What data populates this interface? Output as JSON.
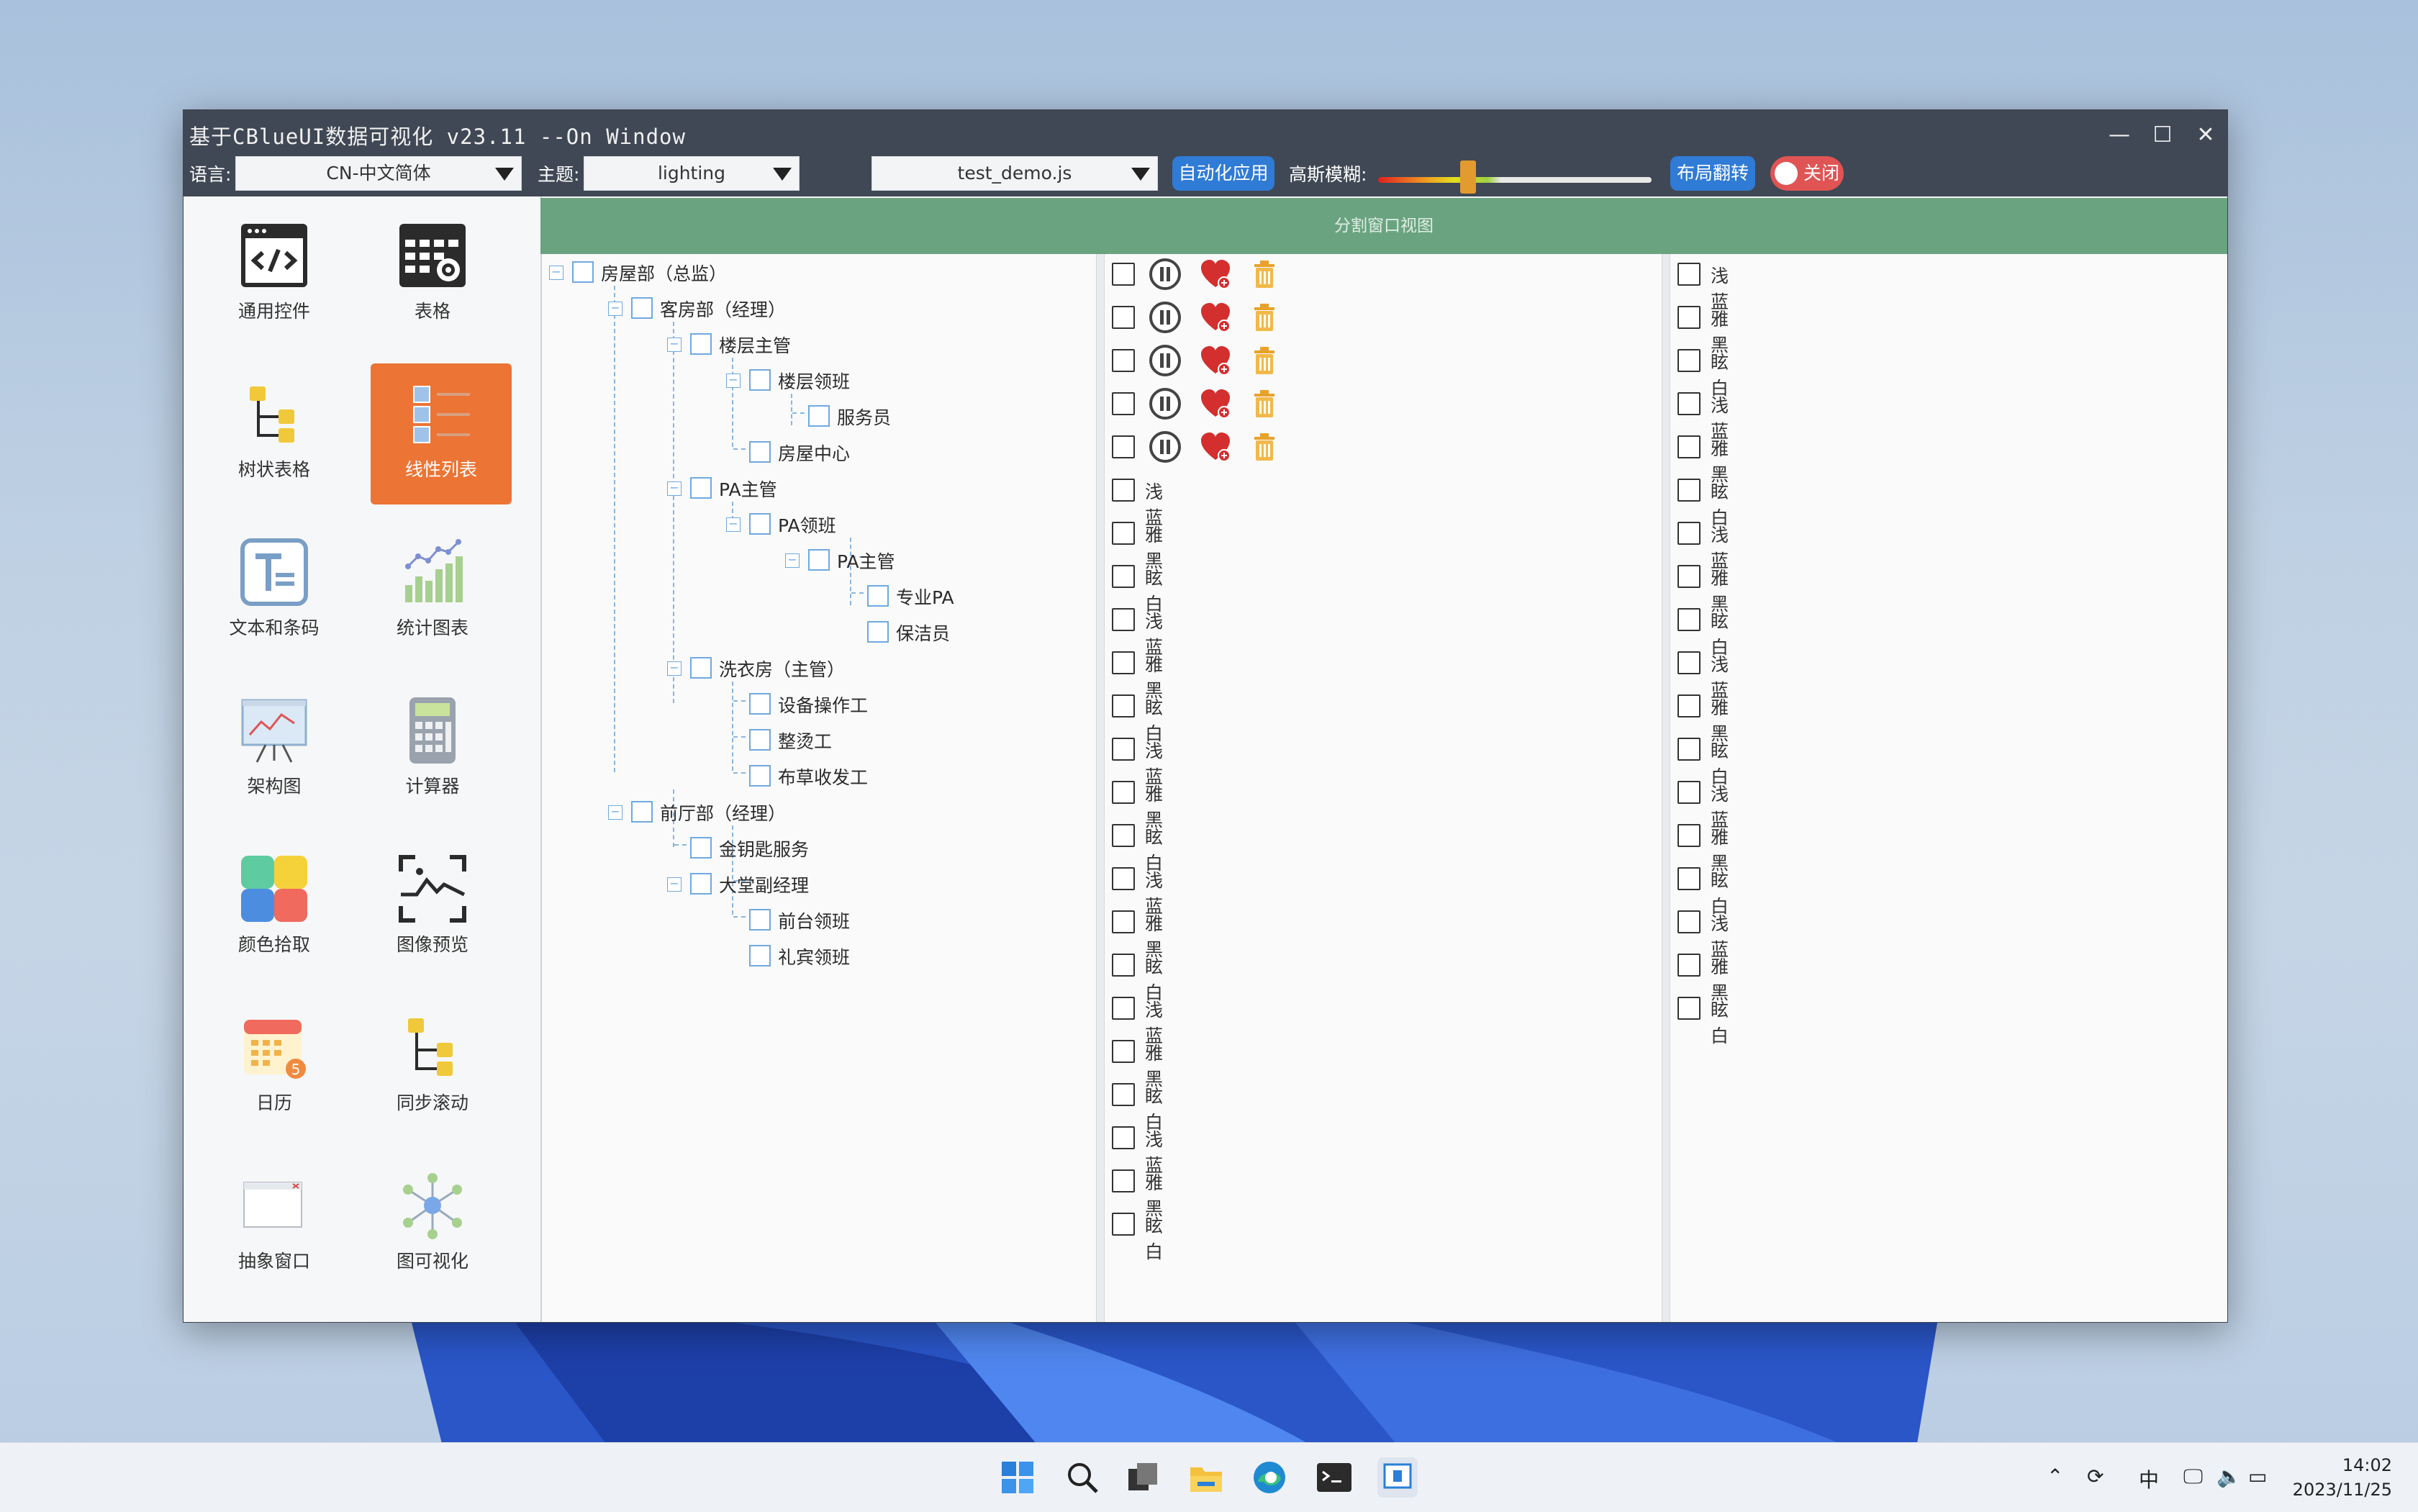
{
  "window": {
    "title": "基于CBlueUI数据可视化 v23.11 --On Window"
  },
  "toolbar": {
    "lang_label": "语言:",
    "lang_value": "CN-中文简体",
    "theme_label": "主题:",
    "theme_value": "lighting",
    "script_value": "test_demo.js",
    "auto_btn": "自动化应用",
    "blur_label": "高斯模糊:",
    "blur_level": 0.33,
    "flip_btn": "布局翻转",
    "toggle_label": "关闭"
  },
  "sidebar": {
    "items": [
      {
        "label": "通用控件",
        "icon": "code-window-icon"
      },
      {
        "label": "表格",
        "icon": "table-gear-icon"
      },
      {
        "label": "树状表格",
        "icon": "tree-table-icon"
      },
      {
        "label": "线性列表",
        "icon": "linear-list-icon",
        "active": true
      },
      {
        "label": "文本和条码",
        "icon": "text-barcode-icon"
      },
      {
        "label": "统计图表",
        "icon": "stats-chart-icon"
      },
      {
        "label": "架构图",
        "icon": "presentation-board-icon"
      },
      {
        "label": "计算器",
        "icon": "calculator-icon"
      },
      {
        "label": "颜色拾取",
        "icon": "color-picker-icon"
      },
      {
        "label": "图像预览",
        "icon": "image-preview-icon"
      },
      {
        "label": "日历",
        "icon": "calendar-icon",
        "badge": "5"
      },
      {
        "label": "同步滚动",
        "icon": "sync-scroll-icon"
      },
      {
        "label": "抽象窗口",
        "icon": "abstract-window-icon"
      },
      {
        "label": "图可视化",
        "icon": "graph-visual-icon"
      }
    ]
  },
  "main": {
    "header": "分割窗口视图",
    "tree": [
      "房屋部（总监）",
      "客房部（经理）",
      "楼层主管",
      "楼层领班",
      "服务员",
      "房屋中心",
      "PA主管",
      "PA领班",
      "PA主管",
      "专业PA",
      "保洁员",
      "洗衣房（主管）",
      "设备操作工",
      "整烫工",
      "布草收发工",
      "前厅部（经理）",
      "金钥匙服务",
      "大堂副经理",
      "前台领班",
      "礼宾领班"
    ],
    "list_middle": [
      "浅蓝",
      "雅黑",
      "眩白",
      "浅蓝",
      "雅黑",
      "眩白",
      "浅蓝",
      "雅黑",
      "眩白",
      "浅蓝",
      "雅黑",
      "眩白",
      "浅蓝",
      "雅黑",
      "眩白",
      "浅蓝",
      "雅黑",
      "眩白"
    ],
    "list_right": [
      "浅蓝",
      "雅黑",
      "眩白",
      "浅蓝",
      "雅黑",
      "眩白",
      "浅蓝",
      "雅黑",
      "眩白",
      "浅蓝",
      "雅黑",
      "眩白",
      "浅蓝",
      "雅黑",
      "眩白",
      "浅蓝",
      "雅黑",
      "眩白"
    ]
  },
  "taskbar": {
    "ime": "中",
    "time": "14:02",
    "date": "2023/11/25"
  },
  "colors": {
    "accent": "#ec7434",
    "header": "#6aa380",
    "titlebar": "#3f4854",
    "button_blue": "#2f7bd6",
    "toggle_red": "#e05454"
  }
}
